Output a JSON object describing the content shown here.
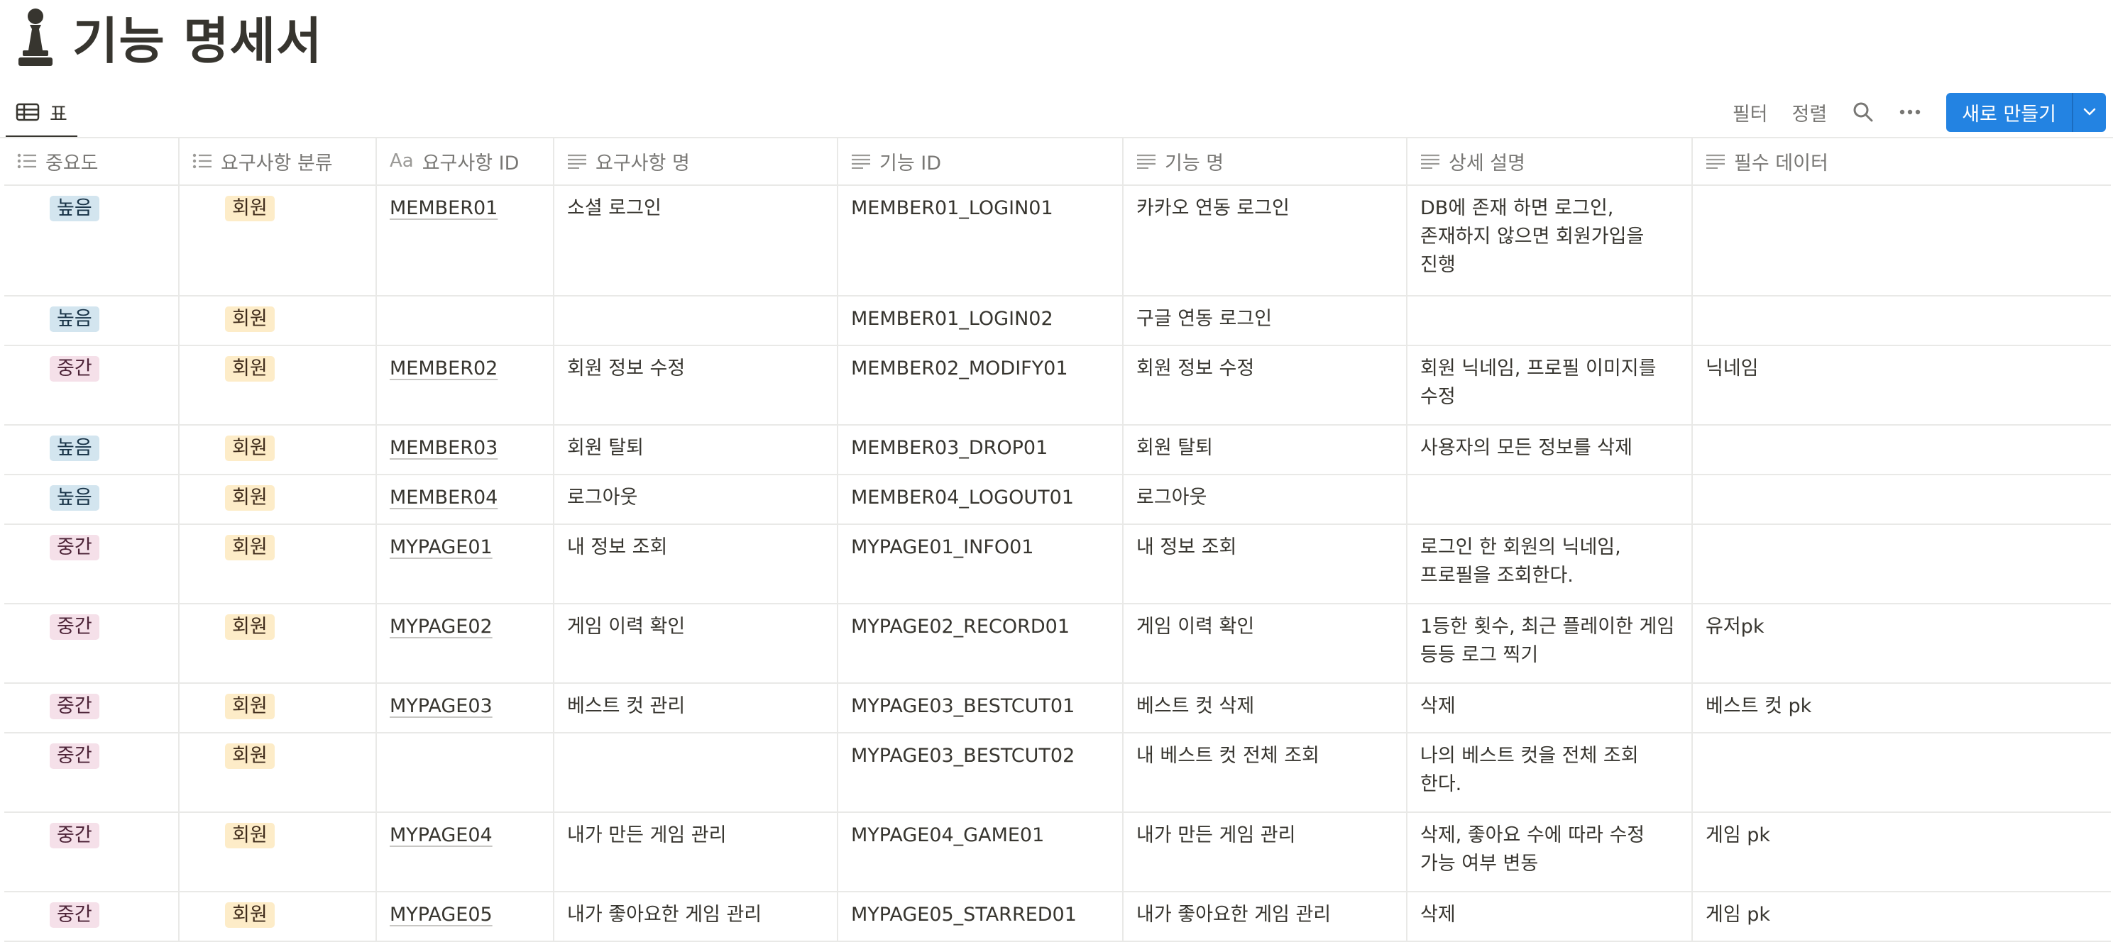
{
  "page": {
    "title": "기능 명세서",
    "icon": "pawn-icon"
  },
  "view": {
    "tab_label": "표",
    "tab_icon": "table-icon"
  },
  "toolbar": {
    "filter_label": "필터",
    "sort_label": "정렬",
    "search_icon": "search-icon",
    "more_icon": "more-icon",
    "new_label": "새로 만들기",
    "new_dropdown_icon": "chevron-down-icon"
  },
  "colors": {
    "accent": "#2383e2",
    "tag_high_bg": "#d3e5ef",
    "tag_mid_bg": "#f5e0e9",
    "tag_member_bg": "#fdecc8"
  },
  "table": {
    "columns": [
      {
        "label": "중요도",
        "icon": "list-icon"
      },
      {
        "label": "요구사항 분류",
        "icon": "list-icon"
      },
      {
        "label": "요구사항 ID",
        "icon": "title-aa-icon",
        "prefix": "Aa"
      },
      {
        "label": "요구사항 명",
        "icon": "text-icon"
      },
      {
        "label": "기능 ID",
        "icon": "text-icon"
      },
      {
        "label": "기능 명",
        "icon": "text-icon"
      },
      {
        "label": "상세 설명",
        "icon": "text-icon"
      },
      {
        "label": "필수 데이터",
        "icon": "text-icon"
      }
    ],
    "rows": [
      {
        "priority": "높음",
        "category": "회원",
        "req_id": "MEMBER01",
        "req_name": "소셜 로그인",
        "func_id": "MEMBER01_LOGIN01",
        "func_name": "카카오 연동 로그인",
        "desc": "DB에 존재 하면 로그인, 존재하지 않으면 회원가입을 진행",
        "data": ""
      },
      {
        "priority": "높음",
        "category": "회원",
        "req_id": "",
        "req_name": "",
        "func_id": "MEMBER01_LOGIN02",
        "func_name": "구글 연동 로그인",
        "desc": "",
        "data": ""
      },
      {
        "priority": "중간",
        "category": "회원",
        "req_id": "MEMBER02",
        "req_name": "회원 정보 수정",
        "func_id": "MEMBER02_MODIFY01",
        "func_name": "회원 정보 수정",
        "desc": "회원 닉네임, 프로필 이미지를 수정",
        "data": "닉네임"
      },
      {
        "priority": "높음",
        "category": "회원",
        "req_id": "MEMBER03",
        "req_name": "회원 탈퇴",
        "func_id": "MEMBER03_DROP01",
        "func_name": "회원 탈퇴",
        "desc": "사용자의 모든 정보를 삭제",
        "data": ""
      },
      {
        "priority": "높음",
        "category": "회원",
        "req_id": "MEMBER04",
        "req_name": "로그아웃",
        "func_id": "MEMBER04_LOGOUT01",
        "func_name": "로그아웃",
        "desc": "",
        "data": ""
      },
      {
        "priority": "중간",
        "category": "회원",
        "req_id": "MYPAGE01",
        "req_name": "내 정보 조회",
        "func_id": "MYPAGE01_INFO01",
        "func_name": "내 정보 조회",
        "desc": "로그인 한 회원의 닉네임, 프로필을 조회한다.",
        "data": ""
      },
      {
        "priority": "중간",
        "category": "회원",
        "req_id": "MYPAGE02",
        "req_name": "게임 이력 확인",
        "func_id": "MYPAGE02_RECORD01",
        "func_name": "게임 이력 확인",
        "desc": "1등한 횟수, 최근 플레이한 게임 등등 로그 찍기",
        "data": "유저pk"
      },
      {
        "priority": "중간",
        "category": "회원",
        "req_id": "MYPAGE03",
        "req_name": "베스트 컷 관리",
        "func_id": "MYPAGE03_BESTCUT01",
        "func_name": "베스트 컷 삭제",
        "desc": "삭제",
        "data": "베스트 컷 pk"
      },
      {
        "priority": "중간",
        "category": "회원",
        "req_id": "",
        "req_name": "",
        "func_id": "MYPAGE03_BESTCUT02",
        "func_name": "내 베스트 컷 전체 조회",
        "desc": "나의 베스트 컷을 전체 조회 한다.",
        "data": ""
      },
      {
        "priority": "중간",
        "category": "회원",
        "req_id": "MYPAGE04",
        "req_name": "내가 만든 게임 관리",
        "func_id": "MYPAGE04_GAME01",
        "func_name": "내가 만든 게임 관리",
        "desc": "삭제, 좋아요 수에 따라 수정 가능 여부 변동",
        "data": "게임 pk"
      },
      {
        "priority": "중간",
        "category": "회원",
        "req_id": "MYPAGE05",
        "req_name": "내가 좋아요한 게임 관리",
        "func_id": "MYPAGE05_STARRED01",
        "func_name": "내가 좋아요한 게임 관리",
        "desc": "삭제",
        "data": "게임 pk"
      }
    ]
  }
}
